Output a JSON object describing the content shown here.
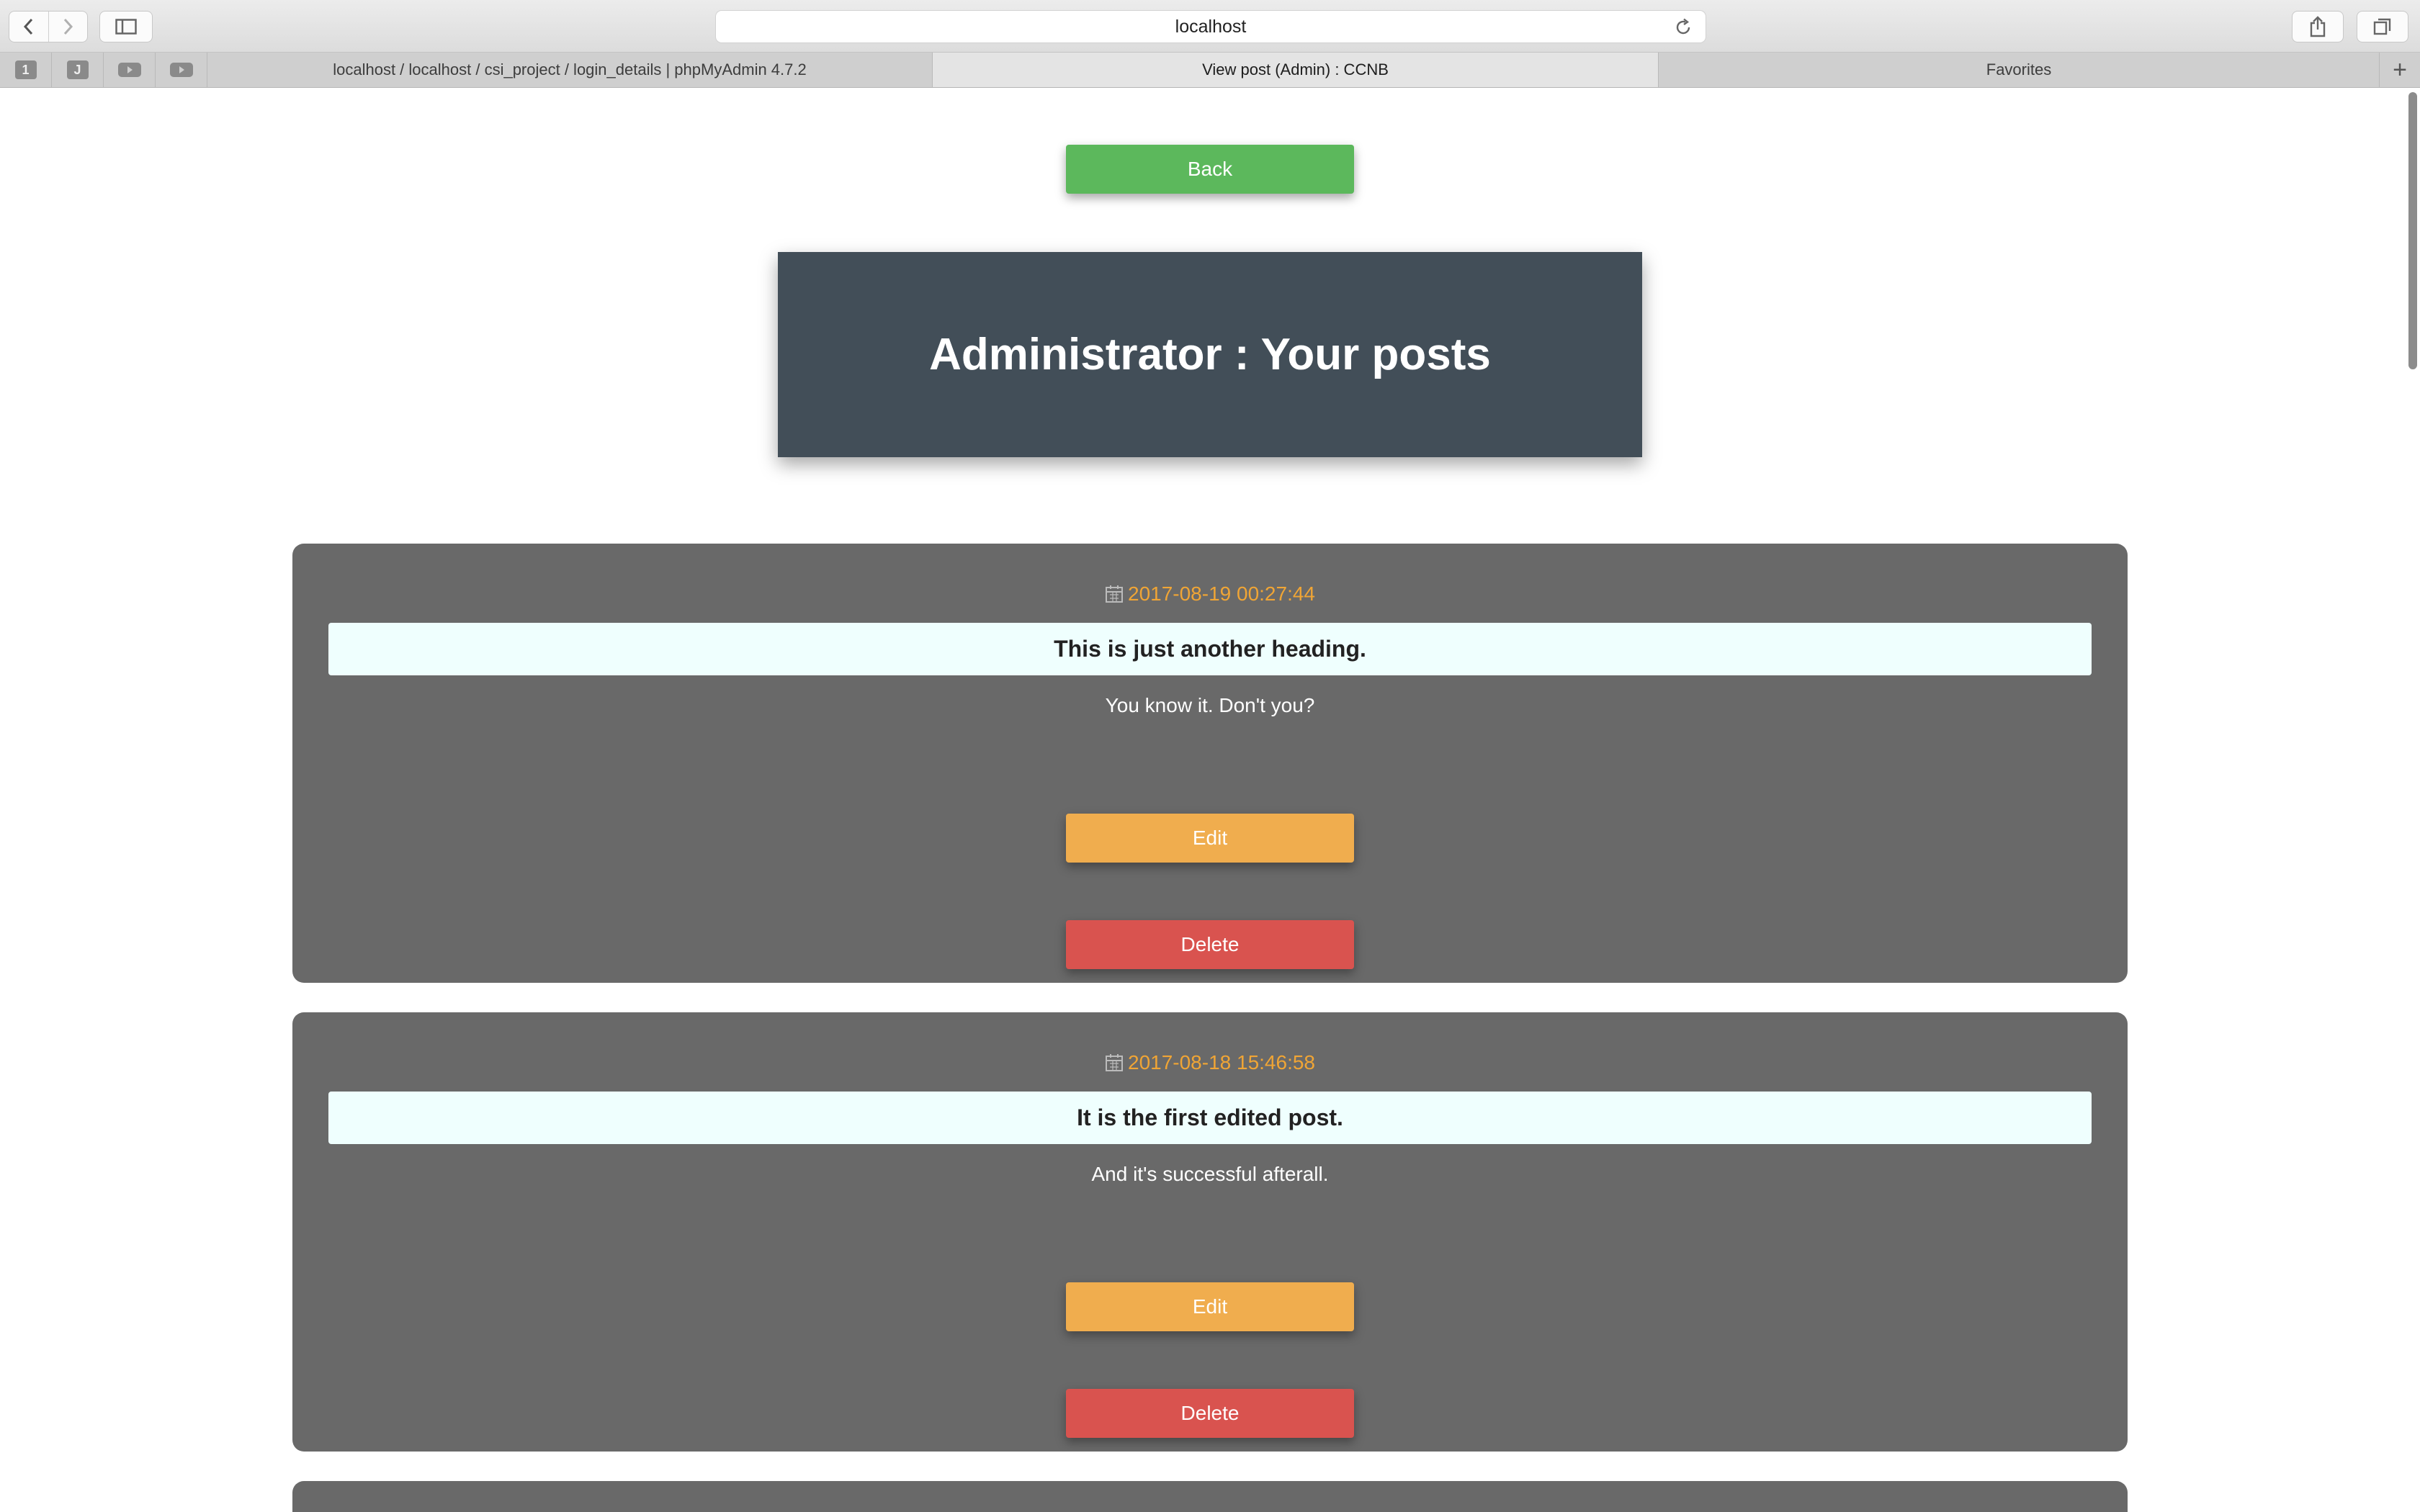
{
  "browser": {
    "url": "localhost",
    "pinned_tabs": [
      "1",
      "J",
      "",
      ""
    ],
    "tabs": [
      {
        "label": "localhost / localhost / csi_project / login_details | phpMyAdmin 4.7.2",
        "active": false
      },
      {
        "label": "View post (Admin) : CCNB",
        "active": true
      },
      {
        "label": "Favorites",
        "active": false
      }
    ]
  },
  "page": {
    "back_label": "Back",
    "title": "Administrator : Your posts",
    "posts": [
      {
        "date": "2017-08-19 00:27:44",
        "heading": "This is just another heading.",
        "body": "You know it. Don't you?",
        "edit_label": "Edit",
        "delete_label": "Delete"
      },
      {
        "date": "2017-08-18 15:46:58",
        "heading": "It is the first edited post.",
        "body": "And it's successful afterall.",
        "edit_label": "Edit",
        "delete_label": "Delete"
      }
    ]
  },
  "colors": {
    "back_button": "#5cb85c",
    "edit_button": "#f0ad4e",
    "delete_button": "#d9534f",
    "header_bg": "#424e58",
    "post_bg": "#696969",
    "date_text": "#f0a535",
    "heading_bg": "#effffe"
  }
}
